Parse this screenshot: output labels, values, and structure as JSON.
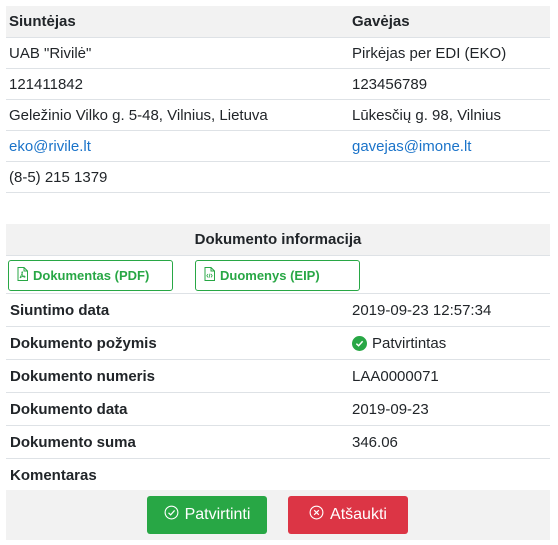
{
  "sender": {
    "heading": "Siuntėjas",
    "name": "UAB \"Rivilė\"",
    "code": "121411842",
    "address": "Geležinio Vilko g. 5-48, Vilnius, Lietuva",
    "email": "eko@rivile.lt",
    "phone": "(8-5) 215 1379"
  },
  "receiver": {
    "heading": "Gavėjas",
    "name": "Pirkėjas per EDI (EKO)",
    "code": "123456789",
    "address": "Lūkesčių g. 98, Vilnius",
    "email": "gavejas@imone.lt"
  },
  "document": {
    "title": "Dokumento informacija",
    "buttons": {
      "pdf_label": "Dokumentas (PDF)",
      "eip_label": "Duomenys (EIP)"
    },
    "rows": [
      {
        "label": "Siuntimo data",
        "value": "2019-09-23 12:57:34"
      },
      {
        "label": "Dokumento požymis",
        "value": "Patvirtintas"
      },
      {
        "label": "Dokumento numeris",
        "value": "LAA0000071"
      },
      {
        "label": "Dokumento data",
        "value": "2019-09-23"
      },
      {
        "label": "Dokumento suma",
        "value": "346.06"
      },
      {
        "label": "Komentaras",
        "value": ""
      }
    ]
  },
  "actions": {
    "confirm_label": "Patvirtinti",
    "cancel_label": "Atšaukti"
  },
  "colors": {
    "success": "#28a745",
    "danger": "#dc3545",
    "link": "#1a73c9",
    "header_bg": "#f2f2f2"
  },
  "icons": {
    "pdf": "file-pdf-icon",
    "eip": "file-code-icon",
    "status": "check-circle-icon",
    "confirm": "check-circle-outline-icon",
    "cancel": "x-circle-outline-icon"
  }
}
